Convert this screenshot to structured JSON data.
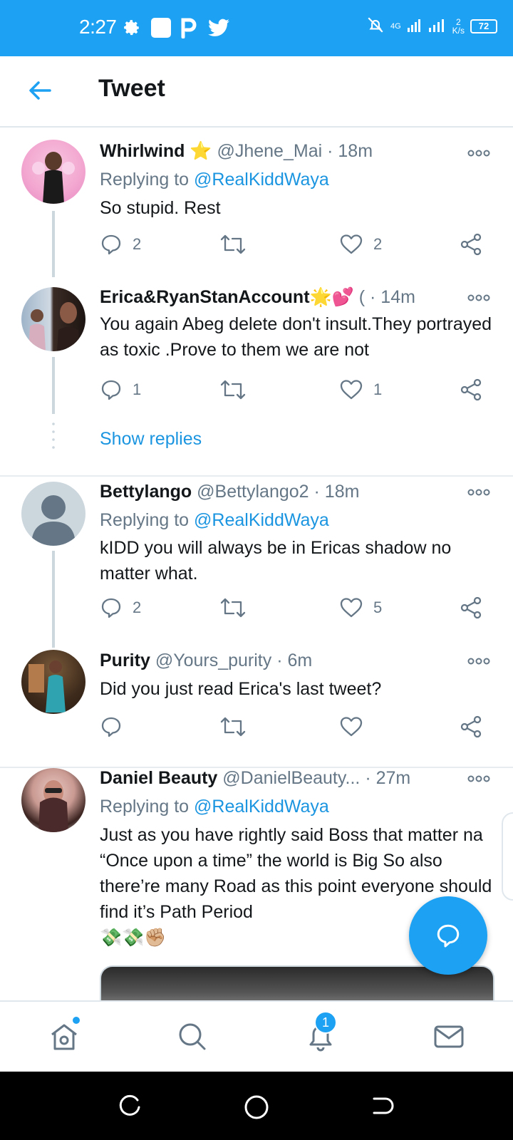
{
  "status_bar": {
    "time": "2:27",
    "net_type": "4G",
    "speed_value": "2",
    "speed_unit": "K/s",
    "battery": "72"
  },
  "header": {
    "title": "Tweet"
  },
  "tweets": [
    {
      "name": "Whirlwind",
      "emoji": "⭐",
      "handle": "@Jhene_Mai",
      "time": "· 18m",
      "replying_label": "Replying to",
      "replying_handle": "@RealKiddWaya",
      "text": "So stupid. Rest",
      "replies": "2",
      "likes": "2"
    },
    {
      "name": "Erica&RyanStanAccount",
      "emoji": "🌟💕",
      "handle": "(",
      "time": "· 14m",
      "text": "You again Abeg delete don't insult.They portrayed as toxic .Prove to them we are not",
      "replies": "1",
      "likes": "1"
    },
    {
      "name": "Bettylango",
      "handle": "@Bettylango2",
      "time": "· 18m",
      "replying_label": "Replying to",
      "replying_handle": "@RealKiddWaya",
      "text": "kIDD you will always be in Ericas shadow no matter what.",
      "replies": "2",
      "likes": "5"
    },
    {
      "name": "Purity",
      "handle": "@Yours_purity",
      "time": "· 6m",
      "text": "Did you just read Erica's last tweet?",
      "replies": "",
      "likes": ""
    },
    {
      "name": "Daniel Beauty",
      "handle": "@DanielBeauty...",
      "time": "· 27m",
      "replying_label": "Replying to",
      "replying_handle": "@RealKiddWaya",
      "text": "Just as you have rightly said Boss that matter na “Once upon a time” the world is Big So also there’re many Road as this point everyone should find it’s Path Period",
      "emoji_line": "💸💸✊🏼"
    }
  ],
  "show_replies": "Show replies",
  "tabbar": {
    "notification_count": "1"
  },
  "colors": {
    "brand": "#1da1f2",
    "link": "#1b95e0",
    "muted": "#657786"
  }
}
